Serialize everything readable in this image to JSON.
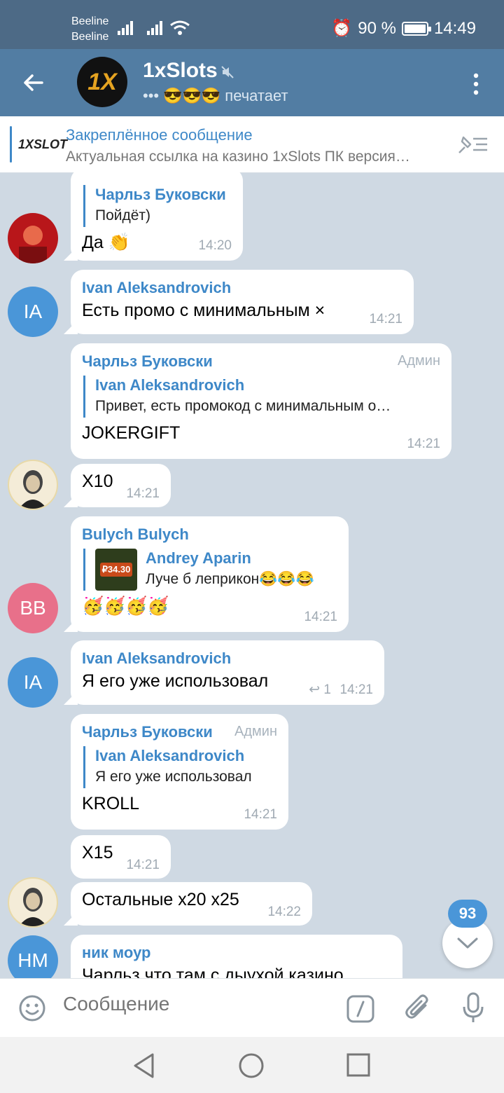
{
  "status": {
    "carrier1": "Beeline",
    "carrier2": "Beeline",
    "battery": "90 %",
    "time": "14:49"
  },
  "header": {
    "title": "1xSlots",
    "subtitle": "печатает",
    "subtitle_emoji": "😎😎😎",
    "avatar_text": "1X"
  },
  "pinned": {
    "title": "Закреплённое сообщение",
    "text": "Актуальная ссылка на казино 1xSlots ПК версия…",
    "logo": "1XSLOT"
  },
  "messages": [
    {
      "reply_name": "Чарльз Буковски",
      "reply_text": "Пойдёт)",
      "text": "Да 👏",
      "time": "14:20"
    },
    {
      "sender": "Ivan Aleksandrovich",
      "text": "Есть промо с минимальным ×",
      "time": "14:21",
      "avatar": "IA"
    },
    {
      "sender": "Чарльз Буковски",
      "admin": "Админ",
      "reply_name": "Ivan Aleksandrovich",
      "reply_text": "Привет, есть промокод с минимальным о…",
      "text": "JOKERGIFT",
      "time": "14:21"
    },
    {
      "text": "X10",
      "time": "14:21"
    },
    {
      "sender": "Bulych Bulych",
      "reply_name": "Andrey Aparin",
      "reply_text": "Луче б леприкон😂😂😂",
      "reply_thumb": "₽34.30",
      "text": "🥳🥳🥳🥳",
      "time": "14:21",
      "avatar": "BB"
    },
    {
      "sender": "Ivan Aleksandrovich",
      "text": "Я его уже использовал",
      "replies": "1",
      "time": "14:21",
      "avatar": "IA"
    },
    {
      "sender": "Чарльз Буковски",
      "admin": "Админ",
      "reply_name": "Ivan Aleksandrovich",
      "reply_text": "Я его уже использовал",
      "text": "KROLL",
      "time": "14:21"
    },
    {
      "text": "X15",
      "time": "14:21"
    },
    {
      "text": "Остальные x20 x25",
      "time": "14:22"
    },
    {
      "sender": "ник моур",
      "text": "Чарльз что там с дыухой казино",
      "avatar": "НМ"
    }
  ],
  "scroll_badge": "93",
  "composer": {
    "placeholder": "Сообщение"
  },
  "colors": {
    "header": "#527da3",
    "statusbar": "#4d6a86",
    "accent": "#3e88c8"
  }
}
